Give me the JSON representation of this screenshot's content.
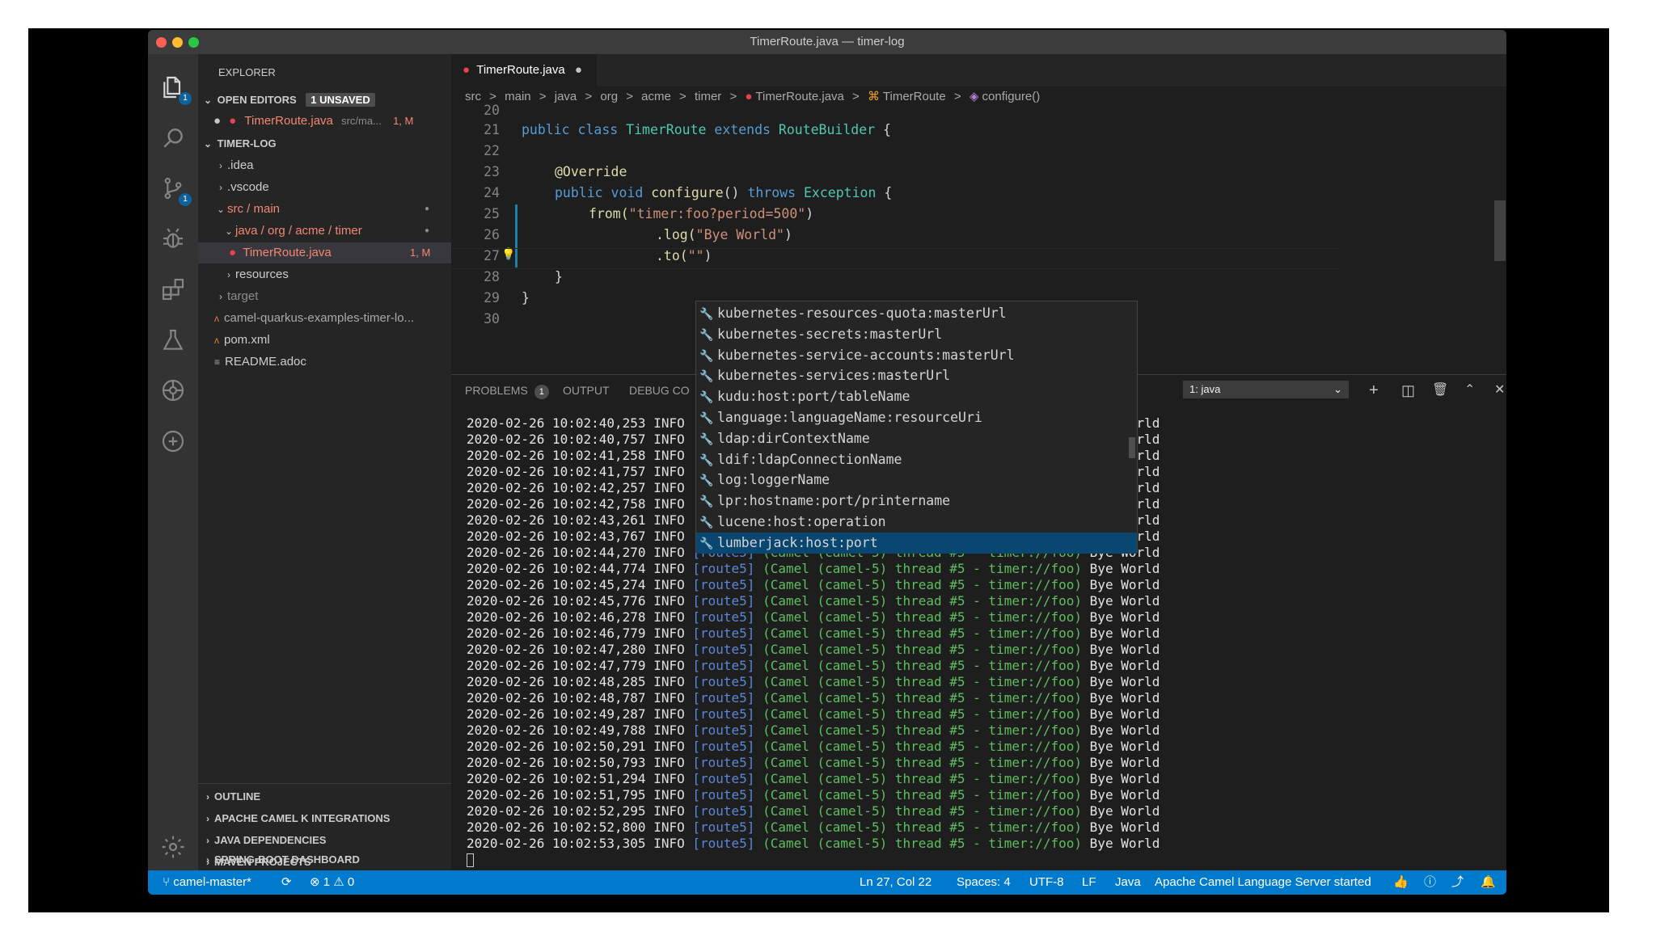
{
  "window": {
    "title": "TimerRoute.java — timer-log"
  },
  "activity": {
    "explorer_badge": "1",
    "scm_badge": "1"
  },
  "sidebar": {
    "header": "EXPLORER",
    "open_editors": "OPEN EDITORS",
    "unsaved": "1 UNSAVED",
    "open_file": {
      "name": "TimerRoute.java",
      "path": "src/ma...",
      "status": "1, M"
    },
    "project": "TIMER-LOG",
    "tree": [
      {
        "label": ".idea"
      },
      {
        "label": ".vscode"
      },
      {
        "label": "src / main"
      },
      {
        "label": "java / org / acme / timer"
      },
      {
        "label": "TimerRoute.java",
        "status": "1, M"
      },
      {
        "label": "resources"
      },
      {
        "label": "target"
      },
      {
        "label": "camel-quarkus-examples-timer-lo..."
      },
      {
        "label": "pom.xml"
      },
      {
        "label": "README.adoc"
      }
    ],
    "sections": [
      "OUTLINE",
      "APACHE CAMEL K INTEGRATIONS",
      "JAVA DEPENDENCIES",
      "MAVEN PROJECTS",
      "SPRING-BOOT DASHBOARD"
    ]
  },
  "tab": {
    "label": "TimerRoute.java",
    "dirty": "●"
  },
  "breadcrumb": [
    "src",
    "main",
    "java",
    "org",
    "acme",
    "timer",
    "TimerRoute.java",
    "TimerRoute",
    "configure()"
  ],
  "breadcrumb_sep": ">",
  "code": {
    "lines": [
      "20",
      "21",
      "22",
      "23",
      "24",
      "25",
      "26",
      "27",
      "28",
      "29",
      "30"
    ],
    "l21": {
      "a": "public class ",
      "b": "TimerRoute",
      "c": " extends ",
      "d": "RouteBuilder",
      "e": " {"
    },
    "l23": "@Override",
    "l24": {
      "a": "public void ",
      "b": "configure",
      "c": "() ",
      "d": "throws ",
      "e": "Exception",
      "f": " {"
    },
    "l25": {
      "a": "from(",
      "b": "\"timer:foo?period=500\"",
      "c": ")"
    },
    "l26": {
      "a": ".log(",
      "b": "\"Bye World\"",
      "c": ")"
    },
    "l27": {
      "a": ".to(",
      "b": "\"\"",
      "c": ")"
    },
    "l28": "}",
    "l29": "}"
  },
  "suggestions": [
    "kubernetes-resources-quota:masterUrl",
    "kubernetes-secrets:masterUrl",
    "kubernetes-service-accounts:masterUrl",
    "kubernetes-services:masterUrl",
    "kudu:host:port/tableName",
    "language:languageName:resourceUri",
    "ldap:dirContextName",
    "ldif:ldapConnectionName",
    "log:loggerName",
    "lpr:hostname:port/printername",
    "lucene:host:operation",
    "lumberjack:host:port"
  ],
  "panel": {
    "problems": "PROBLEMS",
    "problems_count": "1",
    "output": "OUTPUT",
    "debug": "DEBUG CO",
    "terminal_select": "1: java"
  },
  "log": {
    "level": "INFO",
    "route": "[route5]",
    "camel": "(Camel (camel-5) thread #5 - timer://foo)",
    "msg": "Bye World",
    "short_msg": "ye World",
    "timestamps": [
      "2020-02-26 10:02:40,253",
      "2020-02-26 10:02:40,757",
      "2020-02-26 10:02:41,258",
      "2020-02-26 10:02:41,757",
      "2020-02-26 10:02:42,257",
      "2020-02-26 10:02:42,758",
      "2020-02-26 10:02:43,261",
      "2020-02-26 10:02:43,767",
      "2020-02-26 10:02:44,270",
      "2020-02-26 10:02:44,774",
      "2020-02-26 10:02:45,274",
      "2020-02-26 10:02:45,776",
      "2020-02-26 10:02:46,278",
      "2020-02-26 10:02:46,779",
      "2020-02-26 10:02:47,280",
      "2020-02-26 10:02:47,779",
      "2020-02-26 10:02:48,285",
      "2020-02-26 10:02:48,787",
      "2020-02-26 10:02:49,287",
      "2020-02-26 10:02:49,788",
      "2020-02-26 10:02:50,291",
      "2020-02-26 10:02:50,793",
      "2020-02-26 10:02:51,294",
      "2020-02-26 10:02:51,795",
      "2020-02-26 10:02:52,295",
      "2020-02-26 10:02:52,800",
      "2020-02-26 10:02:53,305"
    ]
  },
  "status": {
    "branch": "camel-master*",
    "errors": "1",
    "warnings": "0",
    "position": "Ln 27, Col 22",
    "spaces": "Spaces: 4",
    "encoding": "UTF-8",
    "eol": "LF",
    "language": "Java",
    "camel": "Apache Camel Language Server started"
  }
}
